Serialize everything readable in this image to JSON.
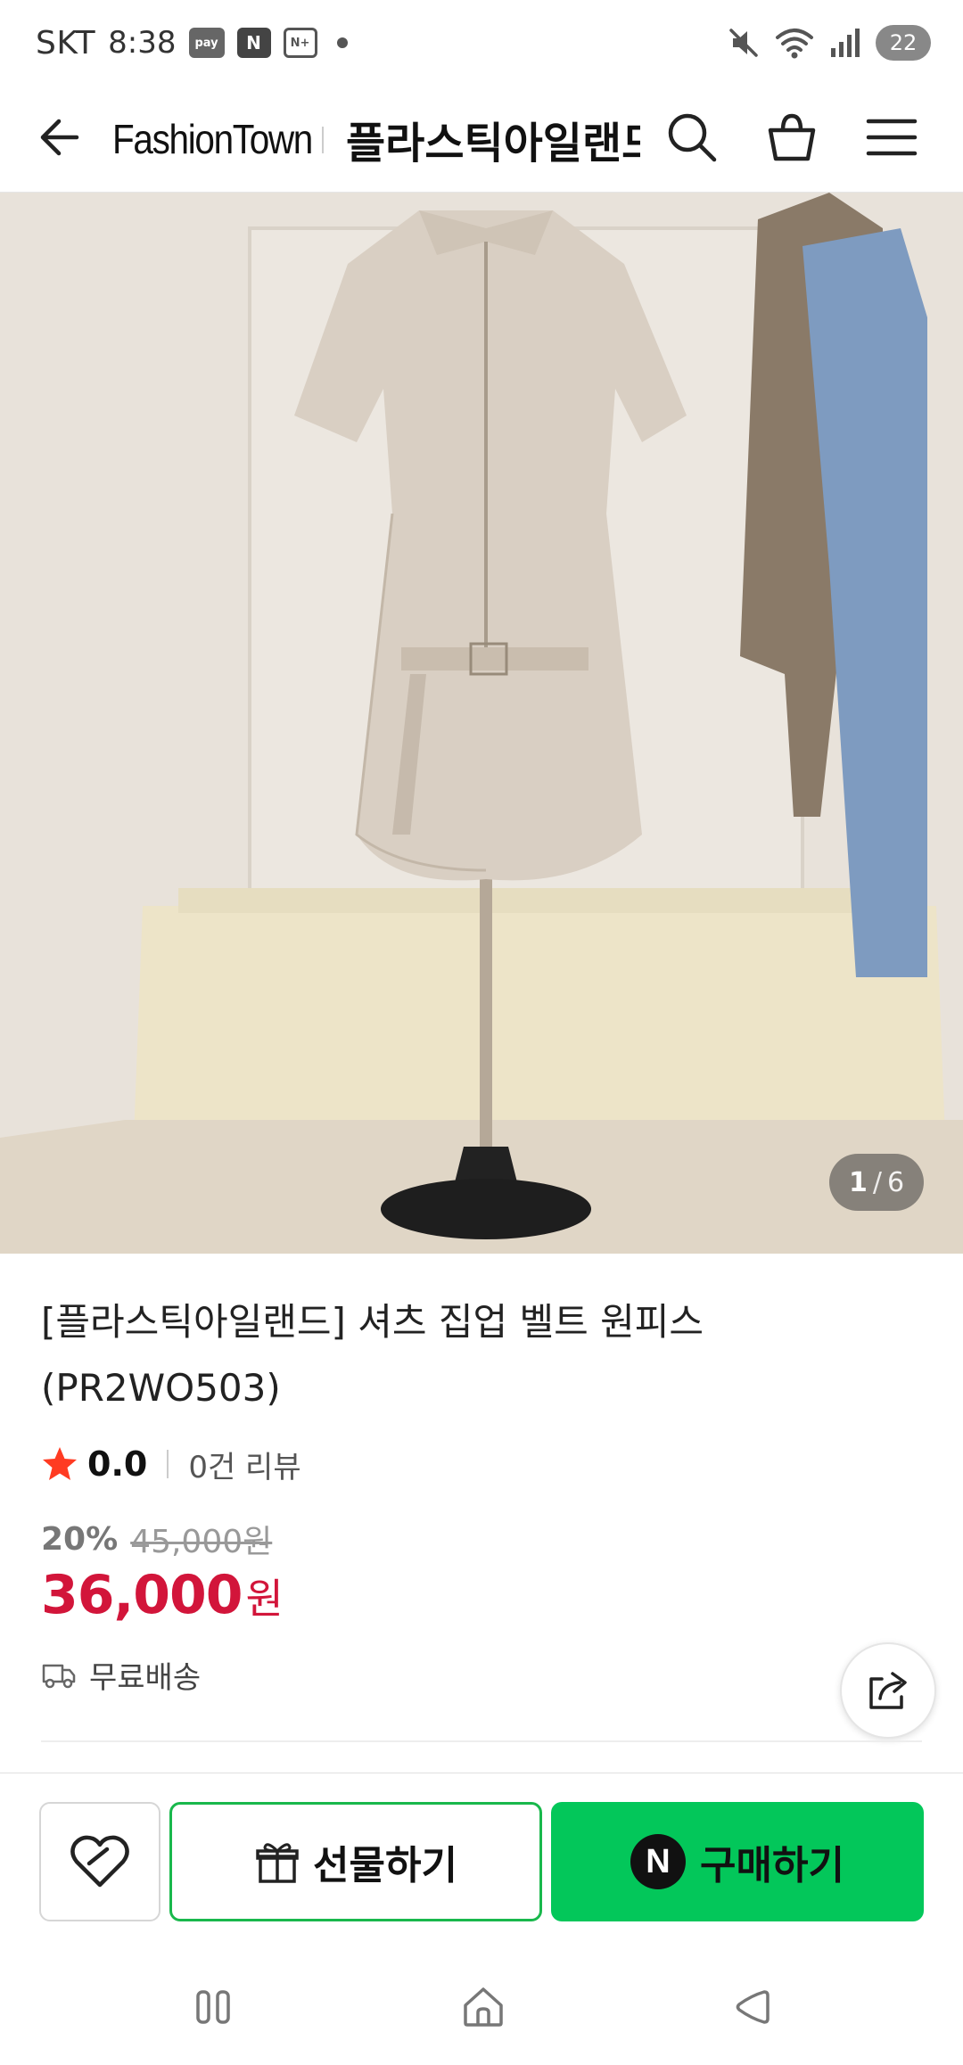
{
  "status_bar": {
    "carrier": "SKT",
    "time": "8:38",
    "app_icons": [
      "pay",
      "N",
      "N+"
    ],
    "battery": "22"
  },
  "header": {
    "brand": "FashionTown",
    "title": "플라스틱아일랜드"
  },
  "gallery": {
    "current": "1",
    "separator": "/",
    "total": "6"
  },
  "product": {
    "title": "[플라스틱아일랜드] 셔츠 집업 벨트 원피스 (PR2WO503)",
    "rating": "0.0",
    "review_count": "0건 리뷰",
    "discount": "20%",
    "original_price": "45,000원",
    "price": "36,000",
    "currency": "원",
    "shipping": "무료배송"
  },
  "actions": {
    "gift_label": "선물하기",
    "buy_badge": "N",
    "buy_label": "구매하기"
  },
  "colors": {
    "accent_green": "#03c75a",
    "price_red": "#d2153a",
    "star_red": "#ff3b22"
  },
  "icons": [
    "back-arrow-icon",
    "search-icon",
    "shopping-bag-icon",
    "hamburger-menu-icon",
    "star-icon",
    "truck-icon",
    "share-icon",
    "heart-icon",
    "gift-icon",
    "naver-n-icon",
    "recent-apps-icon",
    "home-icon",
    "back-nav-icon"
  ]
}
